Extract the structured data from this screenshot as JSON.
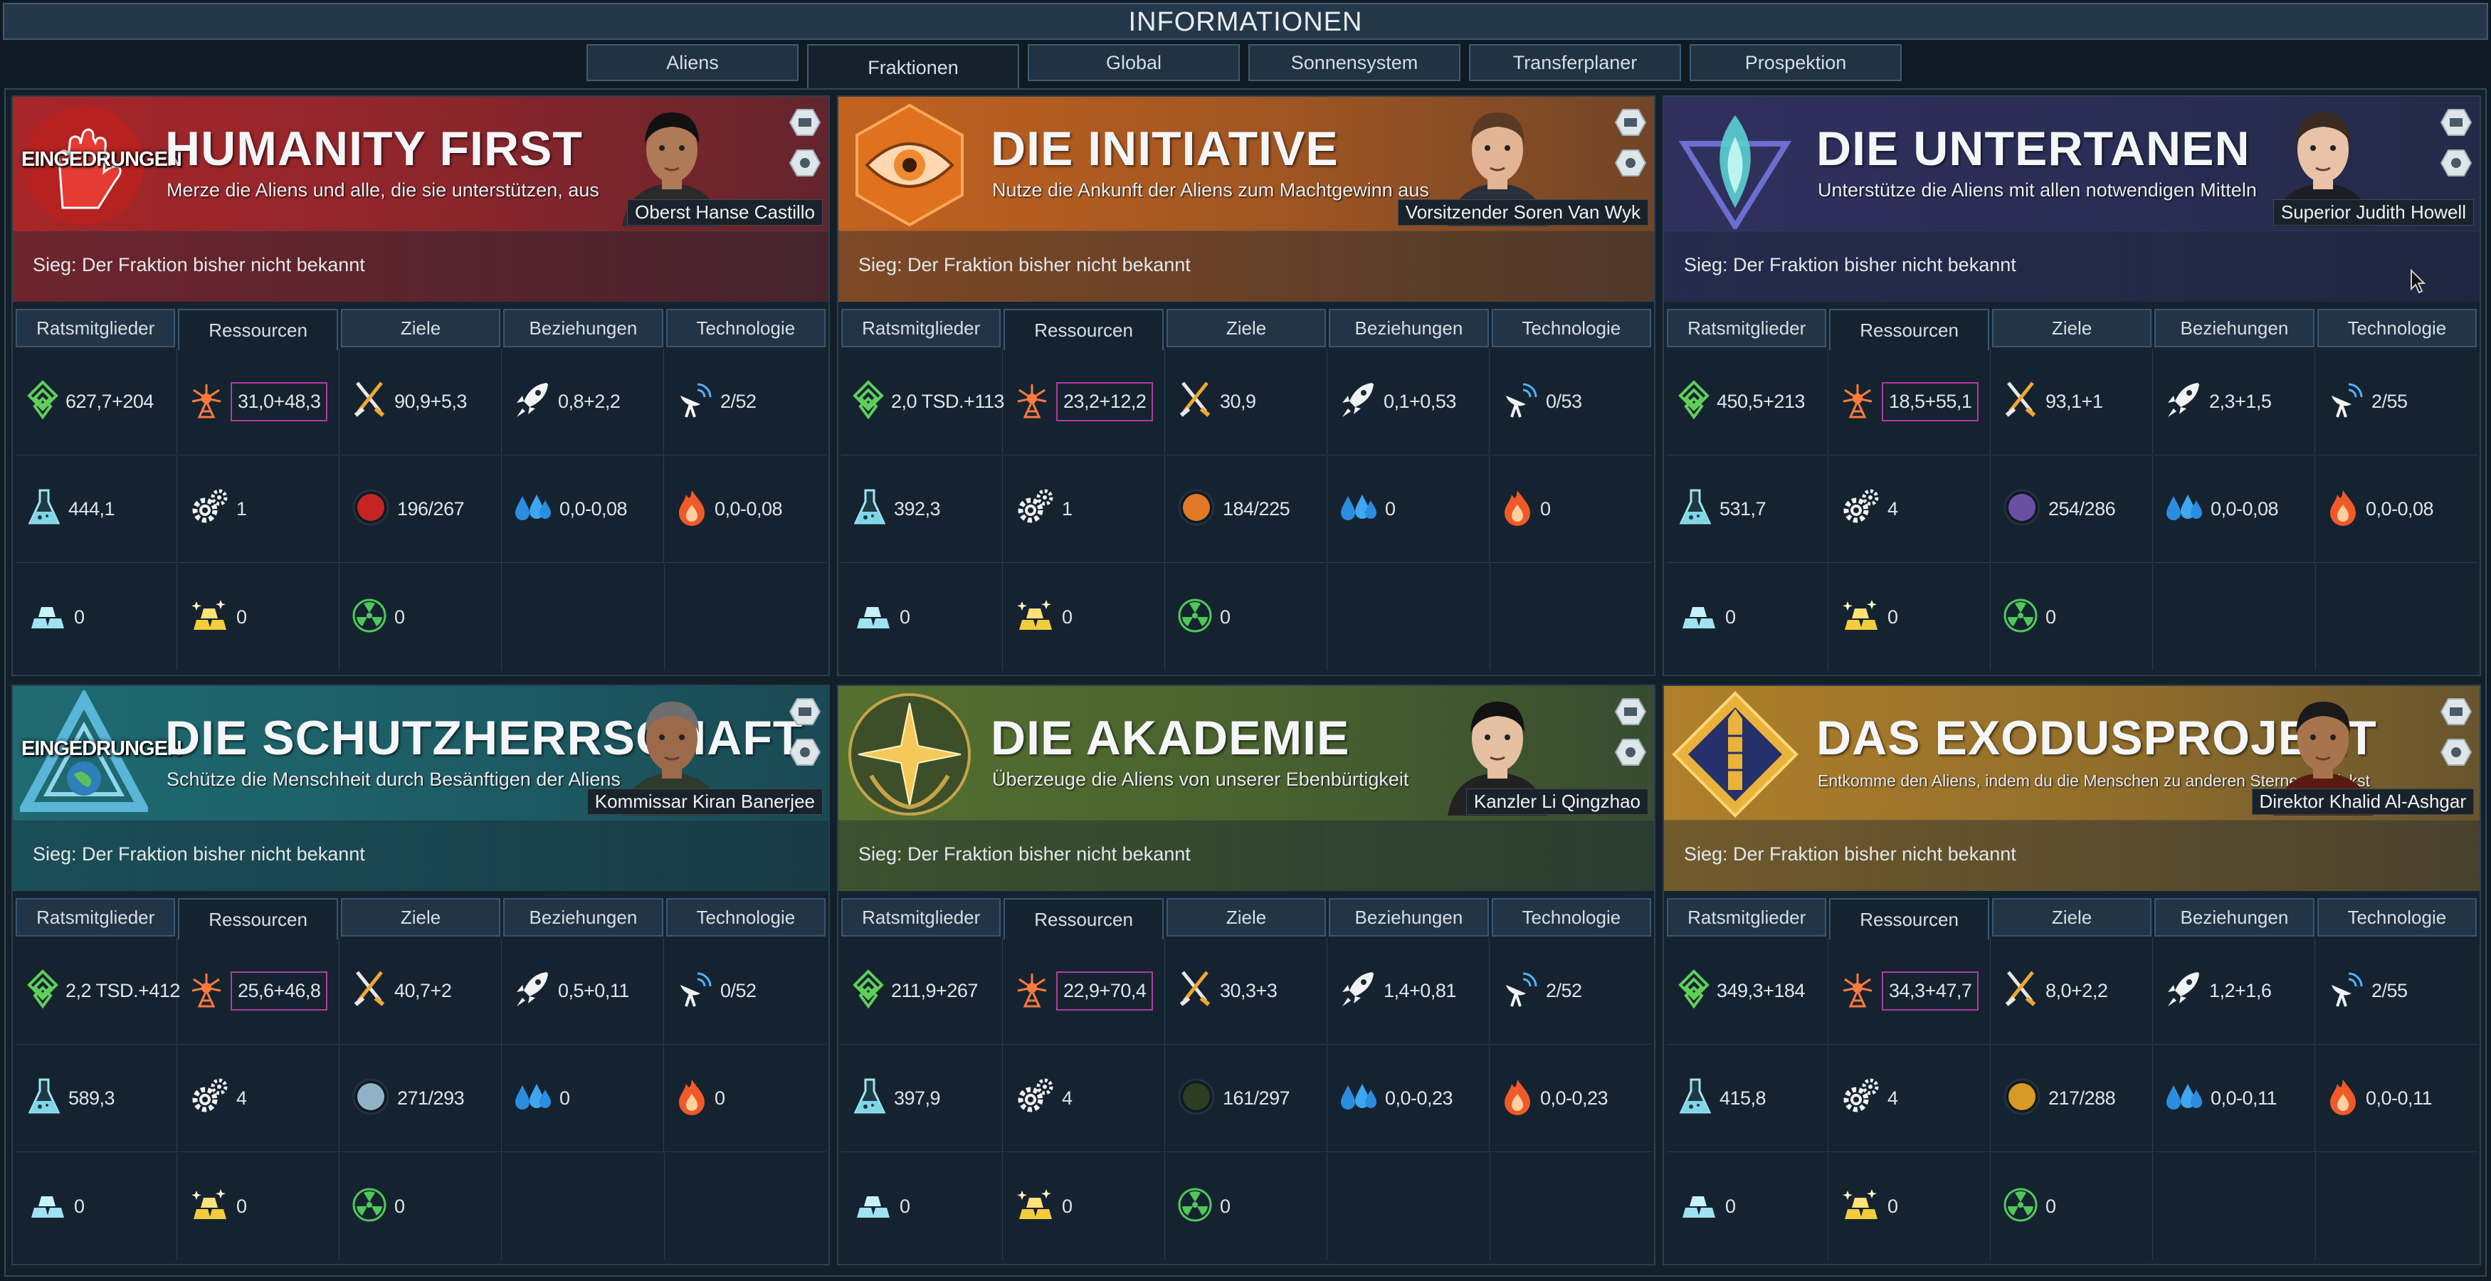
{
  "window": {
    "title": "INFORMATIONEN"
  },
  "tabs": [
    {
      "label": "Aliens",
      "active": false
    },
    {
      "label": "Fraktionen",
      "active": true
    },
    {
      "label": "Global",
      "active": false
    },
    {
      "label": "Sonnensystem",
      "active": false
    },
    {
      "label": "Transferplaner",
      "active": false
    },
    {
      "label": "Prospektion",
      "active": false
    }
  ],
  "panel_tabs": [
    "Ratsmitglieder",
    "Ressourcen",
    "Ziele",
    "Beziehungen",
    "Technologie"
  ],
  "victory_text": "Sieg: Der Fraktion bisher nicht bekannt",
  "factions": [
    {
      "name": "HUMANITY FIRST",
      "infiltrated": "EINGEDRUNGEN",
      "description": "Merze die Aliens und alle, die sie unterstützen, aus",
      "leader": "Oberst Hanse Castillo",
      "color": "#a8262a",
      "emblem": "red-hand-emblem",
      "resources": {
        "money": "627,7+204",
        "influence": "31,0+48,3",
        "ops": "90,9+5,3",
        "boost": "0,8+2,2",
        "mission_control": "2/52",
        "research": "444,1",
        "projects": "1",
        "control_points": "196/267",
        "water": "0,0-0,08",
        "volatiles": "0,0-0,08",
        "metals": "0",
        "noble_metals": "0",
        "fissiles": "0"
      },
      "cp_color": "#c42424"
    },
    {
      "name": "DIE INITIATIVE",
      "infiltrated": "",
      "description": "Nutze die Ankunft der Aliens zum Machtgewinn aus",
      "leader": "Vorsitzender Soren Van Wyk",
      "color": "#c2621f",
      "emblem": "eye-emblem",
      "resources": {
        "money": "2,0 TSD.+113",
        "influence": "23,2+12,2",
        "ops": "30,9",
        "boost": "0,1+0,53",
        "mission_control": "0/53",
        "research": "392,3",
        "projects": "1",
        "control_points": "184/225",
        "water": "0",
        "volatiles": "0",
        "metals": "0",
        "noble_metals": "0",
        "fissiles": "0"
      },
      "cp_color": "#e07a26"
    },
    {
      "name": "DIE UNTERTANEN",
      "infiltrated": "",
      "description": "Unterstütze die Aliens mit allen notwendigen Mitteln",
      "leader": "Superior Judith Howell",
      "color": "#30305e",
      "emblem": "blue-flame-emblem",
      "resources": {
        "money": "450,5+213",
        "influence": "18,5+55,1",
        "ops": "93,1+1",
        "boost": "2,3+1,5",
        "mission_control": "2/55",
        "research": "531,7",
        "projects": "4",
        "control_points": "254/286",
        "water": "0,0-0,08",
        "volatiles": "0,0-0,08",
        "metals": "0",
        "noble_metals": "0",
        "fissiles": "0"
      },
      "cp_color": "#6a4fa4"
    },
    {
      "name": "DIE SCHUTZHERRSCHAFT",
      "infiltrated": "EINGEDRUNGEN",
      "description": "Schütze die Menschheit durch Besänftigen der Aliens",
      "leader": "Kommissar Kiran Banerjee",
      "color": "#1f6b72",
      "emblem": "triangle-earth-emblem",
      "resources": {
        "money": "2,2 TSD.+412",
        "influence": "25,6+46,8",
        "ops": "40,7+2",
        "boost": "0,5+0,11",
        "mission_control": "0/52",
        "research": "589,3",
        "projects": "4",
        "control_points": "271/293",
        "water": "0",
        "volatiles": "0",
        "metals": "0",
        "noble_metals": "0",
        "fissiles": "0"
      },
      "cp_color": "#8fb4c8"
    },
    {
      "name": "DIE AKADEMIE",
      "infiltrated": "",
      "description": "Überzeuge die Aliens von unserer Ebenbürtigkeit",
      "leader": "Kanzler Li Qingzhao",
      "color": "#55702f",
      "emblem": "star-laurel-emblem",
      "resources": {
        "money": "211,9+267",
        "influence": "22,9+70,4",
        "ops": "30,3+3",
        "boost": "1,4+0,81",
        "mission_control": "2/52",
        "research": "397,9",
        "projects": "4",
        "control_points": "161/297",
        "water": "0,0-0,23",
        "volatiles": "0,0-0,23",
        "metals": "0",
        "noble_metals": "0",
        "fissiles": "0"
      },
      "cp_color": "#2c3d22"
    },
    {
      "name": "DAS EXODUSPROJEKT",
      "infiltrated": "",
      "description": "Entkomme den Aliens, indem du die Menschen zu anderen Sternen schickst",
      "leader": "Direktor Khalid Al-Ashgar",
      "color": "#b0802a",
      "emblem": "rocket-diamond-emblem",
      "resources": {
        "money": "349,3+184",
        "influence": "34,3+47,7",
        "ops": "8,0+2,2",
        "boost": "1,2+1,6",
        "mission_control": "2/55",
        "research": "415,8",
        "projects": "4",
        "control_points": "217/288",
        "water": "0,0-0,11",
        "volatiles": "0,0-0,11",
        "metals": "0",
        "noble_metals": "0",
        "fissiles": "0"
      },
      "cp_color": "#d89a24"
    }
  ]
}
